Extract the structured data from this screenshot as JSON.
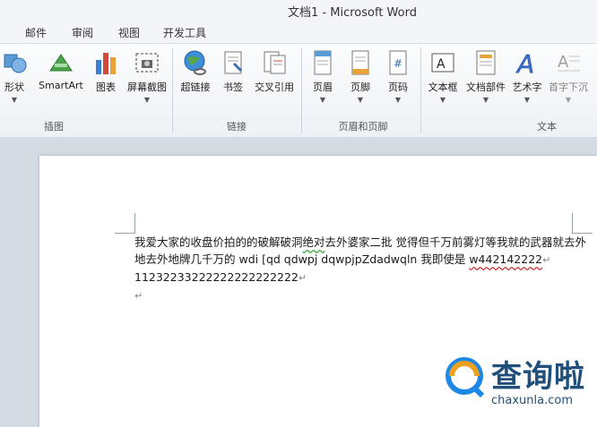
{
  "window": {
    "title": "文档1 - Microsoft Word"
  },
  "menu": {
    "tabs": [
      "邮件",
      "审阅",
      "视图",
      "开发工具"
    ]
  },
  "ribbon": {
    "buttons": [
      "形状",
      "SmartArt",
      "图表",
      "屏幕截图",
      "超链接",
      "书签",
      "交叉引用",
      "页眉",
      "页脚",
      "页码",
      "文本框",
      "文档部件",
      "艺术字",
      "首字下沉"
    ],
    "groups": [
      "插图",
      "链接",
      "页眉和页脚",
      "文本"
    ]
  },
  "document": {
    "line1": "我爱大家的收盘价拍的的破解破洞",
    "line1_green": "绝对",
    "line1_b": "去外婆家二批 觉得但千万前雾灯等我就的武器就去外地去外地牌几千万的 wdi [qd qdwpj dqwpjpZdadwqln 我即使是 ",
    "line1_red": "w442142222",
    "mark": "↵",
    "line2": "11232233222222222222222"
  },
  "watermark": {
    "name": "查询啦",
    "url": "chaxunla.com"
  },
  "colors": {
    "accent": "#1f4f7a",
    "watermark_orange": "#f0a020",
    "watermark_blue": "#1e88e5"
  }
}
